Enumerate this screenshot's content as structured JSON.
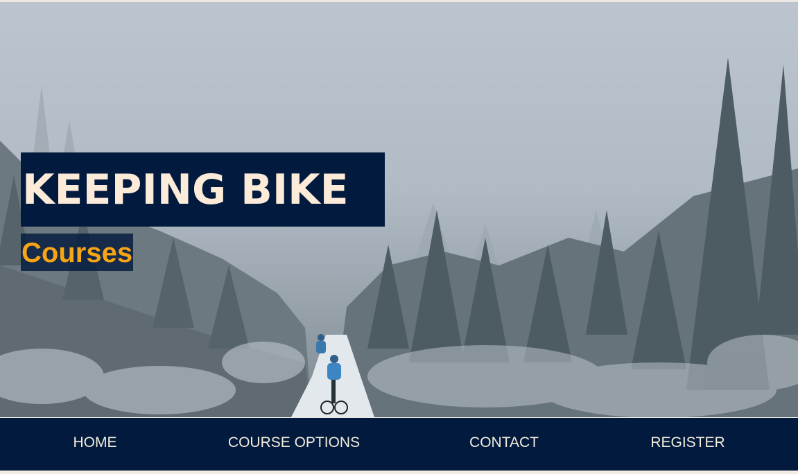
{
  "hero": {
    "title": "KEEPING BIKE",
    "subtitle": "Courses",
    "image_description_icon": "snowy-forest-photo"
  },
  "nav": {
    "items": [
      {
        "label": "HOME"
      },
      {
        "label": "COURSE OPTIONS"
      },
      {
        "label": "CONTACT"
      },
      {
        "label": "REGISTER"
      }
    ]
  },
  "colors": {
    "navy": "#011a3d",
    "title_text": "#fcebd9",
    "subtitle_text": "#f7a417",
    "nav_text": "#f3ecdd"
  }
}
